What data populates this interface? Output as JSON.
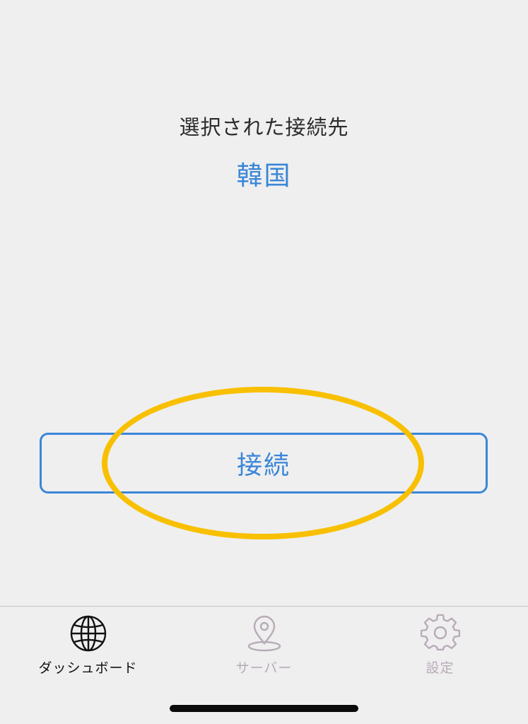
{
  "connection": {
    "selected_label": "選択された接続先",
    "selected_value": "韓国"
  },
  "actions": {
    "connect_label": "接続"
  },
  "tabbar": {
    "tabs": [
      {
        "label": "ダッシュボード",
        "icon": "globe-icon",
        "active": true
      },
      {
        "label": "サーバー",
        "icon": "location-pin-icon",
        "active": false
      },
      {
        "label": "設定",
        "icon": "gear-icon",
        "active": false
      }
    ]
  },
  "colors": {
    "accent": "#3a86d8",
    "highlight": "#f8c000",
    "background": "#efefef",
    "active_tab": "#111111",
    "inactive_tab": "#b7abb7"
  }
}
